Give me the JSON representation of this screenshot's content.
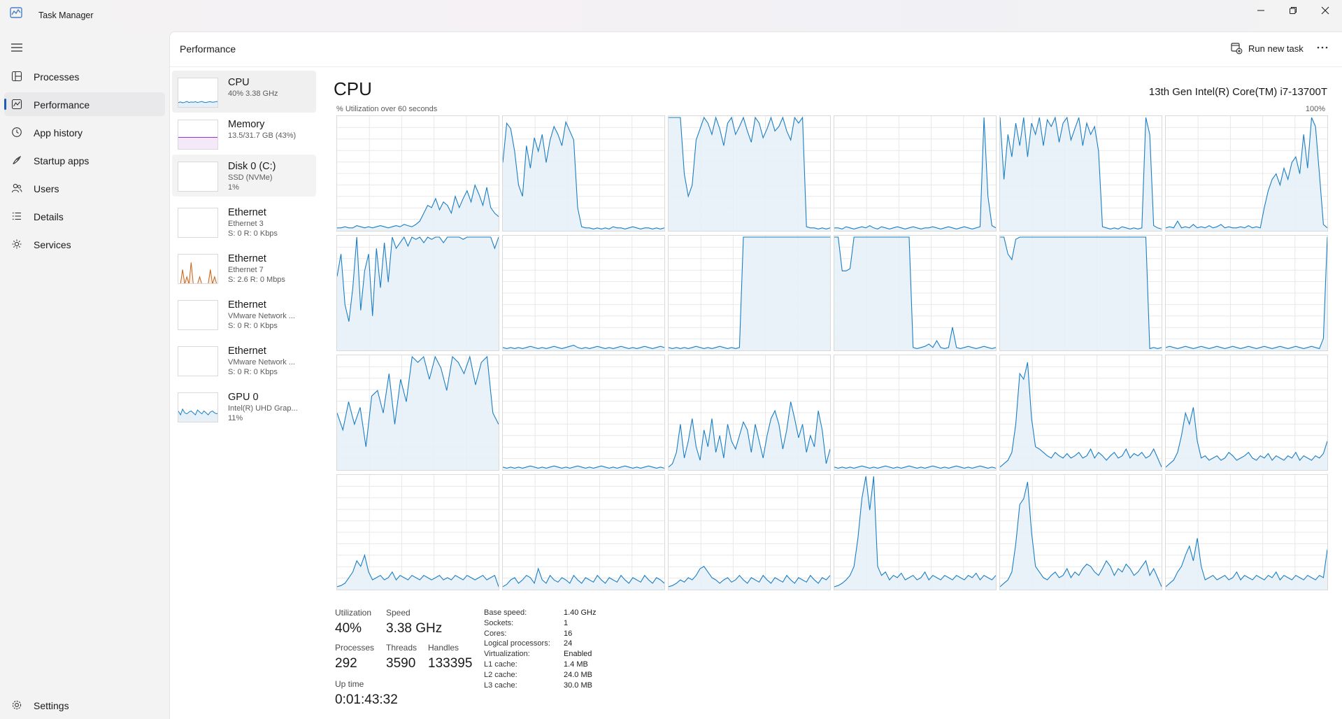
{
  "window": {
    "title": "Task Manager",
    "minimize_icon": "minimize-icon",
    "maximize_icon": "restore-icon",
    "close_icon": "close-icon"
  },
  "nav": {
    "menu_icon": "hamburger-icon",
    "items": [
      {
        "label": "Processes",
        "icon": "processes-icon"
      },
      {
        "label": "Performance",
        "icon": "performance-icon",
        "active": true
      },
      {
        "label": "App history",
        "icon": "app-history-icon"
      },
      {
        "label": "Startup apps",
        "icon": "startup-apps-icon"
      },
      {
        "label": "Users",
        "icon": "users-icon"
      },
      {
        "label": "Details",
        "icon": "details-icon"
      },
      {
        "label": "Services",
        "icon": "services-icon"
      }
    ],
    "settings": {
      "label": "Settings",
      "icon": "gear-icon"
    }
  },
  "header": {
    "title": "Performance",
    "run_new_task": "Run new task",
    "more_icon": "more-icon"
  },
  "devices": [
    {
      "name": "CPU",
      "sub1": "40%  3.38 GHz",
      "sub2": "",
      "color": "#1a7ec4",
      "selected": true
    },
    {
      "name": "Memory",
      "sub1": "13.5/31.7 GB (43%)",
      "sub2": "",
      "color": "#8b2bb0"
    },
    {
      "name": "Disk 0 (C:)",
      "sub1": "SSD (NVMe)",
      "sub2": "1%",
      "color": "#4d9a2a"
    },
    {
      "name": "Ethernet",
      "sub1": "Ethernet 3",
      "sub2": "S: 0  R: 0 Kbps",
      "color": "#c5641a"
    },
    {
      "name": "Ethernet",
      "sub1": "Ethernet 7",
      "sub2": "S: 2.6  R: 0 Mbps",
      "color": "#c5641a"
    },
    {
      "name": "Ethernet",
      "sub1": "VMware Network ...",
      "sub2": "S: 0  R: 0 Kbps",
      "color": "#c5641a"
    },
    {
      "name": "Ethernet",
      "sub1": "VMware Network ...",
      "sub2": "S: 0  R: 0 Kbps",
      "color": "#c5641a"
    },
    {
      "name": "GPU 0",
      "sub1": "Intel(R) UHD Grap...",
      "sub2": "11%",
      "color": "#1a7ec4"
    }
  ],
  "cpu": {
    "title": "CPU",
    "model": "13th Gen Intel(R) Core(TM) i7-13700T",
    "util_label": "% Utilization over 60 seconds",
    "util_max": "100%",
    "line_color": "#1a7ec4",
    "fill_color": "#e6f0f8",
    "grid_color": "#e8e8e8",
    "cores_utilization_approx": [
      [
        2,
        2,
        3,
        2,
        2,
        4,
        3,
        2,
        3,
        2,
        3,
        4,
        3,
        2,
        3,
        4,
        3,
        5,
        4,
        3,
        5,
        8,
        15,
        22,
        20,
        28,
        18,
        25,
        22,
        15,
        30,
        20,
        28,
        35,
        25,
        40,
        32,
        22,
        38,
        20,
        15,
        12
      ],
      [
        60,
        95,
        90,
        70,
        40,
        30,
        75,
        55,
        82,
        70,
        85,
        60,
        80,
        92,
        85,
        75,
        96,
        88,
        80,
        20,
        3,
        2,
        2,
        1,
        2,
        1,
        2,
        1,
        3,
        2,
        2,
        1,
        2,
        3,
        2,
        1,
        2,
        2,
        1,
        2,
        1,
        2
      ],
      [
        100,
        100,
        100,
        100,
        50,
        30,
        40,
        80,
        90,
        100,
        95,
        85,
        100,
        90,
        75,
        95,
        100,
        85,
        92,
        100,
        88,
        78,
        100,
        95,
        82,
        90,
        100,
        88,
        92,
        100,
        88,
        80,
        100,
        95,
        100,
        3,
        2,
        2,
        1,
        2,
        1,
        2
      ],
      [
        2,
        2,
        1,
        3,
        2,
        1,
        2,
        3,
        2,
        4,
        2,
        1,
        3,
        2,
        1,
        2,
        3,
        2,
        1,
        2,
        3,
        2,
        1,
        2,
        2,
        3,
        2,
        1,
        2,
        3,
        2,
        1,
        2,
        3,
        2,
        1,
        2,
        3,
        100,
        30,
        4,
        2
      ],
      [
        100,
        45,
        85,
        65,
        95,
        75,
        100,
        65,
        95,
        85,
        100,
        75,
        98,
        92,
        100,
        78,
        95,
        100,
        80,
        90,
        100,
        75,
        95,
        85,
        92,
        70,
        3,
        2,
        1,
        2,
        1,
        3,
        2,
        1,
        2,
        1,
        2,
        100,
        85,
        4,
        2,
        1
      ],
      [
        2,
        3,
        2,
        8,
        2,
        3,
        2,
        5,
        2,
        3,
        2,
        4,
        2,
        3,
        5,
        2,
        3,
        2,
        2,
        3,
        2,
        4,
        2,
        3,
        2,
        20,
        35,
        45,
        50,
        40,
        55,
        45,
        60,
        65,
        50,
        85,
        55,
        100,
        92,
        50,
        5,
        2
      ],
      [
        65,
        85,
        40,
        25,
        55,
        100,
        35,
        70,
        85,
        30,
        90,
        55,
        95,
        60,
        100,
        90,
        95,
        100,
        92,
        100,
        98,
        100,
        95,
        100,
        98,
        100,
        100,
        95,
        100,
        100,
        100,
        100,
        98,
        100,
        100,
        100,
        100,
        100,
        100,
        100,
        90,
        100
      ],
      [
        2,
        1,
        2,
        1,
        2,
        1,
        2,
        3,
        2,
        1,
        2,
        1,
        2,
        3,
        2,
        1,
        2,
        3,
        4,
        2,
        1,
        2,
        1,
        2,
        3,
        2,
        1,
        2,
        1,
        2,
        3,
        2,
        1,
        2,
        1,
        2,
        3,
        2,
        1,
        2,
        3,
        2
      ],
      [
        2,
        1,
        2,
        1,
        2,
        1,
        2,
        3,
        2,
        1,
        2,
        1,
        2,
        3,
        2,
        1,
        2,
        1,
        2,
        100,
        100,
        100,
        100,
        100,
        100,
        100,
        100,
        100,
        100,
        100,
        100,
        100,
        100,
        100,
        100,
        100,
        100,
        100,
        100,
        100,
        100,
        100
      ],
      [
        100,
        100,
        70,
        70,
        72,
        100,
        100,
        100,
        100,
        100,
        100,
        100,
        100,
        100,
        100,
        100,
        100,
        100,
        100,
        100,
        2,
        1,
        2,
        3,
        5,
        2,
        8,
        2,
        1,
        2,
        20,
        2,
        1,
        2,
        3,
        2,
        1,
        2,
        3,
        2,
        1,
        2
      ],
      [
        100,
        100,
        85,
        80,
        98,
        100,
        100,
        100,
        100,
        100,
        100,
        100,
        100,
        100,
        100,
        100,
        100,
        100,
        100,
        100,
        100,
        100,
        100,
        100,
        100,
        100,
        100,
        100,
        100,
        100,
        100,
        100,
        100,
        100,
        100,
        100,
        100,
        100,
        1,
        2,
        1,
        2
      ],
      [
        2,
        3,
        2,
        1,
        2,
        3,
        2,
        1,
        2,
        3,
        2,
        1,
        2,
        3,
        2,
        1,
        2,
        3,
        2,
        1,
        2,
        3,
        2,
        1,
        2,
        3,
        2,
        1,
        2,
        3,
        2,
        1,
        2,
        3,
        2,
        1,
        2,
        3,
        2,
        1,
        10,
        100
      ],
      [
        50,
        35,
        60,
        40,
        55,
        20,
        65,
        70,
        50,
        85,
        40,
        80,
        60,
        100,
        95,
        100,
        80,
        100,
        90,
        70,
        100,
        95,
        85,
        100,
        75,
        95,
        100,
        50,
        40
      ],
      [
        2,
        1,
        2,
        1,
        2,
        1,
        2,
        3,
        2,
        1,
        2,
        1,
        2,
        3,
        2,
        1,
        2,
        1,
        2,
        3,
        2,
        1,
        2,
        1,
        2,
        3,
        2,
        1,
        2,
        1,
        2,
        3,
        2,
        1,
        2,
        1,
        2,
        3,
        2,
        1,
        2,
        1
      ],
      [
        2,
        5,
        15,
        40,
        10,
        25,
        45,
        20,
        8,
        35,
        20,
        45,
        15,
        30,
        10,
        40,
        25,
        18,
        30,
        42,
        35,
        15,
        40,
        25,
        10,
        30,
        45,
        52,
        40,
        18,
        35,
        60,
        45,
        28,
        40,
        15,
        30,
        20,
        52,
        35,
        5,
        18
      ],
      [
        2,
        1,
        2,
        1,
        2,
        1,
        2,
        3,
        2,
        1,
        2,
        1,
        2,
        3,
        2,
        1,
        2,
        1,
        2,
        3,
        2,
        1,
        2,
        1,
        2,
        3,
        2,
        1,
        2,
        1,
        2,
        3,
        2,
        1,
        2,
        1,
        2,
        3,
        2,
        1,
        2,
        1
      ],
      [
        2,
        5,
        8,
        15,
        40,
        85,
        80,
        95,
        45,
        20,
        18,
        15,
        12,
        10,
        15,
        12,
        10,
        14,
        10,
        12,
        15,
        10,
        12,
        18,
        10,
        15,
        12,
        8,
        12,
        15,
        10,
        12,
        18,
        10,
        14,
        12,
        15,
        10,
        12,
        18,
        10,
        2
      ],
      [
        2,
        5,
        8,
        15,
        30,
        50,
        40,
        55,
        25,
        10,
        12,
        8,
        10,
        12,
        8,
        10,
        15,
        12,
        8,
        10,
        12,
        15,
        10,
        8,
        12,
        10,
        14,
        8,
        12,
        10,
        8,
        12,
        10,
        15,
        8,
        12,
        10,
        8,
        12,
        10,
        14,
        25
      ],
      [
        2,
        3,
        5,
        10,
        15,
        25,
        20,
        30,
        15,
        8,
        10,
        12,
        8,
        10,
        15,
        8,
        12,
        10,
        8,
        12,
        10,
        8,
        12,
        10,
        8,
        10,
        12,
        8,
        10,
        8,
        12,
        10,
        8,
        12,
        10,
        8,
        10,
        12,
        8,
        10,
        12,
        2
      ],
      [
        2,
        4,
        8,
        10,
        5,
        8,
        12,
        10,
        5,
        18,
        8,
        5,
        12,
        8,
        6,
        10,
        8,
        5,
        12,
        8,
        5,
        10,
        8,
        6,
        12,
        8,
        5,
        10,
        8,
        6,
        12,
        8,
        5,
        10,
        8,
        6,
        12,
        8,
        5,
        10,
        8,
        5
      ],
      [
        2,
        3,
        5,
        8,
        6,
        10,
        8,
        12,
        18,
        20,
        15,
        10,
        8,
        5,
        8,
        10,
        6,
        8,
        12,
        8,
        5,
        10,
        8,
        6,
        12,
        8,
        5,
        10,
        8,
        6,
        12,
        8,
        5,
        10,
        8,
        6,
        12,
        8,
        5,
        10,
        8,
        12
      ],
      [
        2,
        3,
        5,
        8,
        12,
        20,
        45,
        80,
        100,
        70,
        100,
        20,
        12,
        15,
        8,
        12,
        10,
        14,
        8,
        10,
        12,
        8,
        10,
        15,
        8,
        12,
        10,
        8,
        12,
        10,
        8,
        12,
        10,
        8,
        12,
        10,
        14,
        8,
        12,
        10,
        8,
        12
      ],
      [
        2,
        5,
        8,
        15,
        40,
        75,
        80,
        95,
        50,
        20,
        15,
        10,
        8,
        12,
        15,
        10,
        12,
        18,
        10,
        15,
        12,
        18,
        22,
        20,
        15,
        12,
        18,
        25,
        20,
        12,
        18,
        15,
        22,
        18,
        12,
        15,
        20,
        25,
        12,
        18,
        10,
        2
      ],
      [
        2,
        5,
        8,
        15,
        20,
        30,
        38,
        25,
        45,
        20,
        8,
        10,
        12,
        8,
        10,
        12,
        8,
        10,
        15,
        8,
        12,
        10,
        8,
        12,
        10,
        8,
        12,
        10,
        15,
        8,
        12,
        10,
        8,
        12,
        10,
        8,
        12,
        10,
        8,
        12,
        10,
        35
      ]
    ]
  },
  "stats": {
    "utilization_label": "Utilization",
    "utilization": "40%",
    "speed_label": "Speed",
    "speed": "3.38 GHz",
    "processes_label": "Processes",
    "processes": "292",
    "threads_label": "Threads",
    "threads": "3590",
    "handles_label": "Handles",
    "handles": "133395",
    "uptime_label": "Up time",
    "uptime": "0:01:43:32"
  },
  "specs": [
    {
      "key": "Base speed:",
      "value": "1.40 GHz"
    },
    {
      "key": "Sockets:",
      "value": "1"
    },
    {
      "key": "Cores:",
      "value": "16"
    },
    {
      "key": "Logical processors:",
      "value": "24"
    },
    {
      "key": "Virtualization:",
      "value": "Enabled"
    },
    {
      "key": "L1 cache:",
      "value": "1.4 MB"
    },
    {
      "key": "L2 cache:",
      "value": "24.0 MB"
    },
    {
      "key": "L3 cache:",
      "value": "30.0 MB"
    }
  ],
  "device_thumbnails": {
    "cpu": [
      18,
      20,
      17,
      19,
      22,
      18,
      20,
      19,
      21,
      18,
      20,
      22,
      19,
      18,
      20,
      21,
      19,
      20,
      22,
      18
    ],
    "memory": [
      43,
      43,
      43,
      43,
      43,
      43,
      43,
      43,
      43,
      43,
      43,
      43,
      43,
      43,
      43,
      43,
      43,
      43,
      43,
      43
    ],
    "disk": [
      1,
      1,
      1,
      1,
      1,
      1,
      1,
      1,
      1,
      1,
      1,
      1,
      1,
      1,
      1,
      1,
      1,
      1,
      1,
      1
    ],
    "eth7": [
      0,
      0,
      2,
      0,
      1,
      0,
      3,
      0,
      0,
      0,
      1,
      0,
      0,
      0,
      0,
      2,
      0,
      1,
      0,
      0
    ],
    "gpu": [
      12,
      8,
      14,
      10,
      9,
      11,
      12,
      10,
      8,
      13,
      11,
      9,
      12,
      10,
      8,
      11,
      12,
      10,
      9,
      11
    ]
  }
}
